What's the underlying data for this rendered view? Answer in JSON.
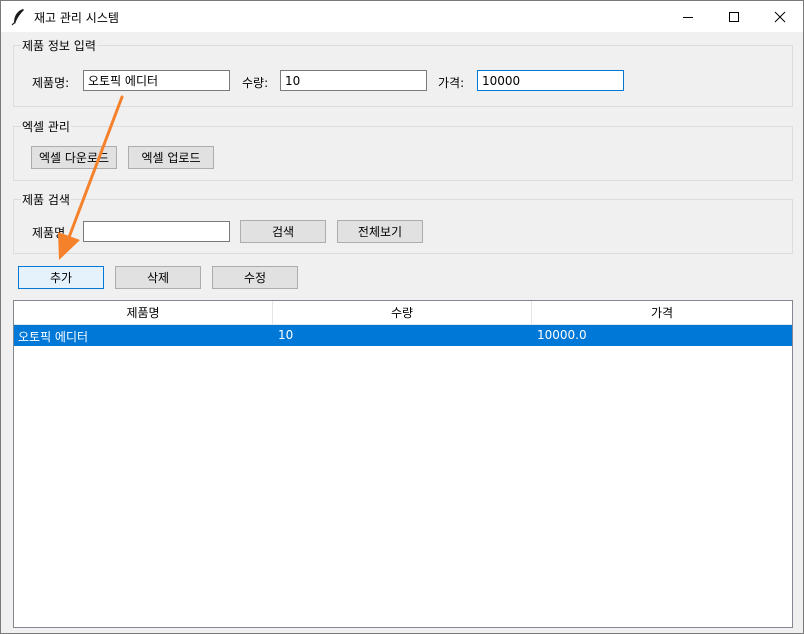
{
  "window": {
    "title": "재고 관리 시스템"
  },
  "product_info": {
    "title": "제품 정보 입력",
    "name_label": "제품명:",
    "name_value": "오토픽 에디터",
    "qty_label": "수량:",
    "qty_value": "10",
    "price_label": "가격:",
    "price_value": "10000"
  },
  "excel": {
    "title": "엑셀 관리",
    "download_label": "엑셀 다운로드",
    "upload_label": "엑셀 업로드"
  },
  "search": {
    "title": "제품 검색",
    "name_label": "제품명",
    "name_value": "",
    "search_label": "검색",
    "show_all_label": "전체보기"
  },
  "actions": {
    "add_label": "추가",
    "delete_label": "삭제",
    "edit_label": "수정"
  },
  "table": {
    "columns": [
      "제품명",
      "수량",
      "가격"
    ],
    "rows": [
      {
        "name": "오토픽 에디터",
        "qty": "10",
        "price": "10000.0",
        "selected": true
      }
    ]
  },
  "colors": {
    "selection": "#0078d7",
    "annotation_arrow": "#f5822a"
  }
}
